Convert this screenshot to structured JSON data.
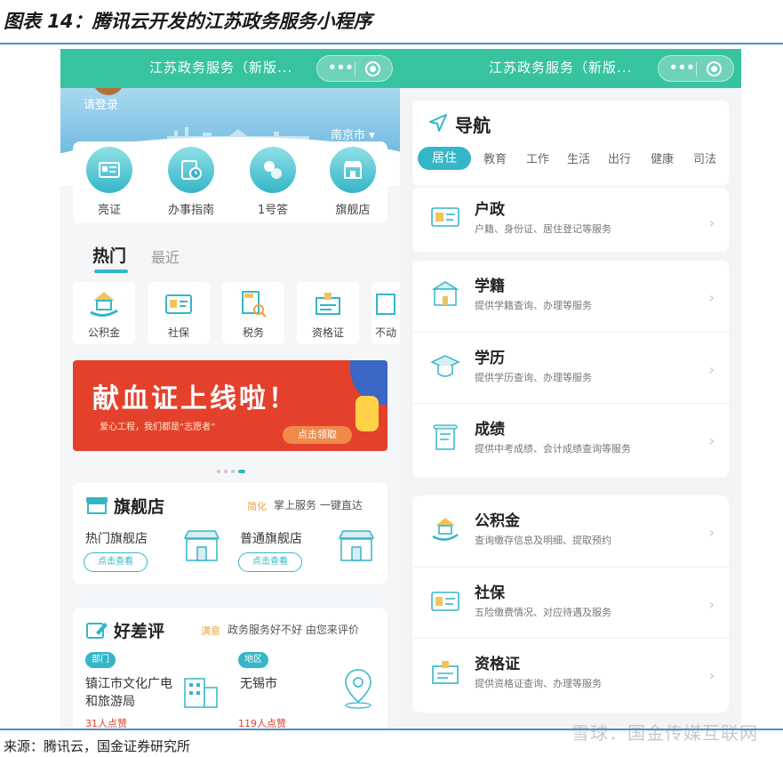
{
  "figure": {
    "title": "图表 14：腾讯云开发的江苏政务服务小程序",
    "source": "来源：腾讯云，国金证券研究所",
    "watermark": "雪球：国金传媒互联网"
  },
  "left_screen": {
    "navbar_title": "江苏政务服务（新版...",
    "capsule_more": "•••",
    "login_text": "请登录",
    "city": "南京市 ▾",
    "quick_actions": [
      {
        "label": "亮证",
        "icon": "id-card-icon"
      },
      {
        "label": "办事指南",
        "icon": "guide-clock-icon"
      },
      {
        "label": "1号答",
        "icon": "chat-bubbles-icon"
      },
      {
        "label": "旗舰店",
        "icon": "store-icon"
      }
    ],
    "tabs": {
      "hot": "热门",
      "recent": "最近"
    },
    "hot_items": [
      {
        "label": "公积金",
        "icon": "house-fund-icon"
      },
      {
        "label": "社保",
        "icon": "social-security-card-icon"
      },
      {
        "label": "税务",
        "icon": "tax-search-icon"
      },
      {
        "label": "资格证",
        "icon": "certificate-icon"
      },
      {
        "label": "不动",
        "icon": "property-icon"
      }
    ],
    "promo": {
      "title": "献血证上线啦！",
      "subtitle": "爱心工程，我们都是“志愿者”",
      "button": "点击领取"
    },
    "flagship": {
      "title": "旗舰店",
      "tag": "简化",
      "desc": "掌上服务 一键直达",
      "stores": [
        {
          "name": "热门旗舰店",
          "button": "点击查看"
        },
        {
          "name": "普通旗舰店",
          "button": "点击查看"
        }
      ]
    },
    "review": {
      "title": "好差评",
      "tag": "满意",
      "desc": "政务服务好不好 由您来评价",
      "items": [
        {
          "chip": "部门",
          "name_line1": "镇江市文化广电",
          "name_line2": "和旅游局",
          "likes": "31人点赞"
        },
        {
          "chip": "地区",
          "name_line1": "无锡市",
          "name_line2": "",
          "likes": "119人点赞"
        }
      ]
    }
  },
  "right_screen": {
    "navbar_title": "江苏政务服务（新版...",
    "capsule_more": "•••",
    "nav_title": "导航",
    "categories": [
      "居住",
      "教育",
      "工作",
      "生活",
      "出行",
      "健康",
      "司法"
    ],
    "active_category": "居住",
    "services_group1": [
      {
        "title": "户政",
        "desc": "户籍、身份证、居住登记等服务",
        "icon": "household-icon"
      }
    ],
    "services_group2": [
      {
        "title": "学籍",
        "desc": "提供学籍查询、办理等服务",
        "icon": "school-building-icon"
      },
      {
        "title": "学历",
        "desc": "提供学历查询、办理等服务",
        "icon": "graduation-cap-icon"
      },
      {
        "title": "成绩",
        "desc": "提供中考成绩、会计成绩查询等服务",
        "icon": "scroll-icon"
      }
    ],
    "services_group3": [
      {
        "title": "公积金",
        "desc": "查询缴存信息及明细、提取预约",
        "icon": "house-fund-icon"
      },
      {
        "title": "社保",
        "desc": "五险缴费情况、对应待遇及服务",
        "icon": "social-security-card-icon"
      },
      {
        "title": "资格证",
        "desc": "提供资格证查询、办理等服务",
        "icon": "certificate-icon"
      }
    ],
    "chevron": "›"
  },
  "colors": {
    "navbar": "#37c3a0",
    "accent": "#35b6c8",
    "promo_red": "#e4412c",
    "rule_blue": "#4b8dd0"
  }
}
